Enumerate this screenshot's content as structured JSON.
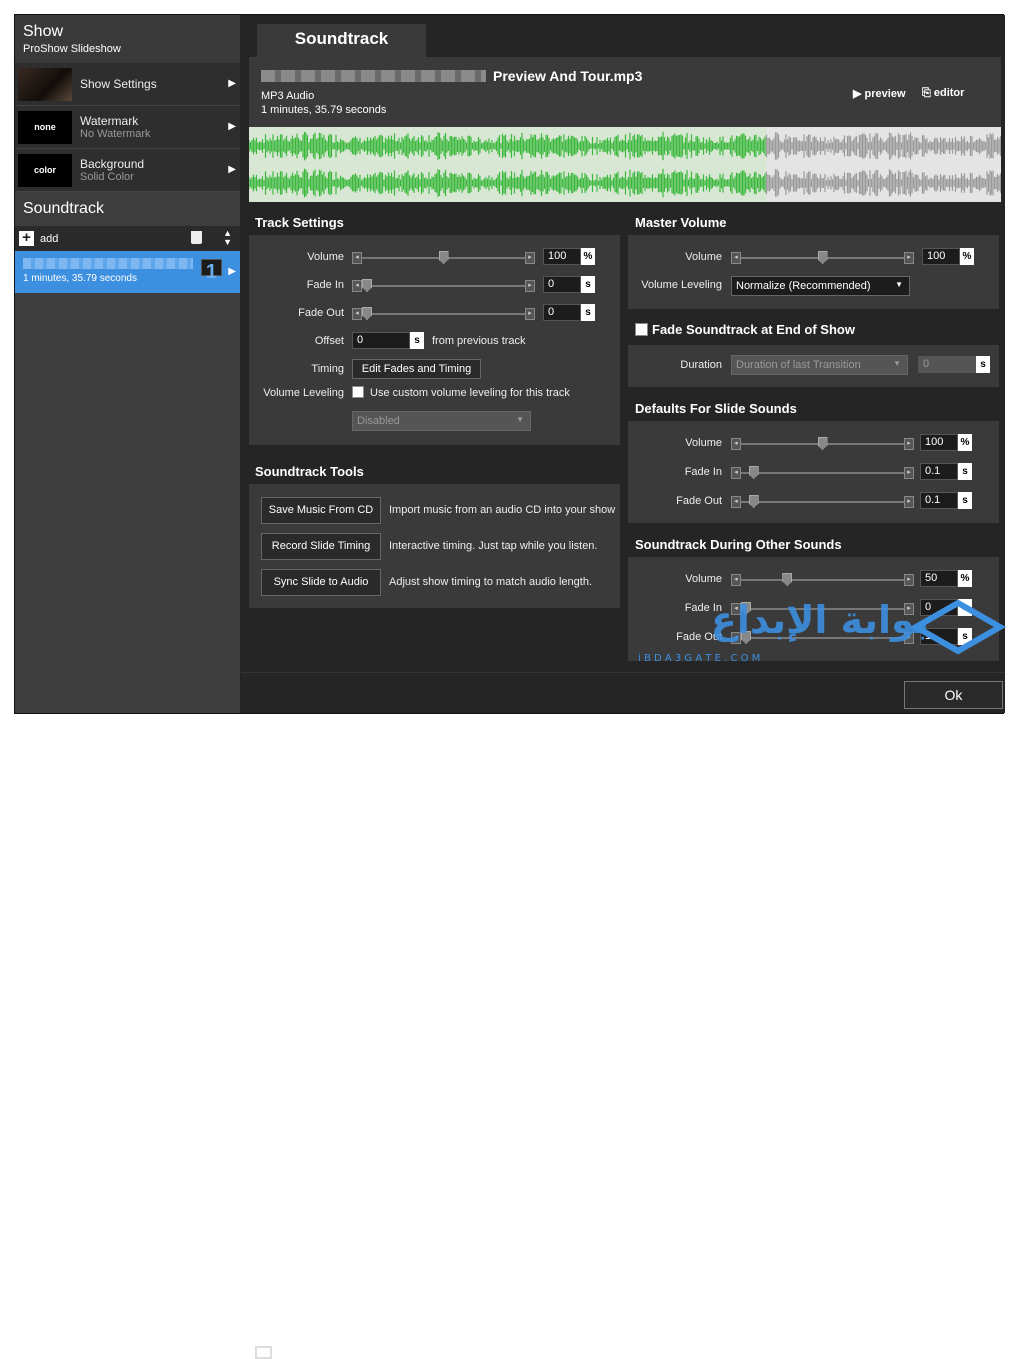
{
  "sidebar": {
    "show_title": "Show",
    "show_subtitle": "ProShow Slideshow",
    "items": [
      {
        "label": "Show Settings",
        "sub": "",
        "thumb": ""
      },
      {
        "label": "Watermark",
        "sub": "No Watermark",
        "thumb": "none"
      },
      {
        "label": "Background",
        "sub": "Solid Color",
        "thumb": "color"
      }
    ],
    "soundtrack_heading": "Soundtrack",
    "add_label": "add",
    "track": {
      "duration": "1 minutes, 35.79 seconds",
      "index": "1"
    }
  },
  "tab": "Soundtrack",
  "file": {
    "name": "Preview And Tour.mp3",
    "type": "MP3 Audio",
    "length": "1 minutes, 35.79 seconds",
    "preview_label": "preview",
    "editor_label": "editor",
    "played_fraction": 0.688
  },
  "track_settings": {
    "title": "Track Settings",
    "volume": {
      "label": "Volume",
      "value": "100",
      "unit": "%",
      "level": 0.5
    },
    "fade_in": {
      "label": "Fade In",
      "value": "0",
      "unit": "s",
      "level": 0
    },
    "fade_out": {
      "label": "Fade Out",
      "value": "0",
      "unit": "s",
      "level": 0
    },
    "offset": {
      "label": "Offset",
      "value": "0",
      "unit": "s",
      "suffix": "from previous track"
    },
    "timing": {
      "label": "Timing",
      "button": "Edit Fades and Timing"
    },
    "leveling": {
      "label": "Volume Leveling",
      "checkbox": "Use custom volume leveling for this track",
      "dropdown": "Disabled"
    }
  },
  "master_volume": {
    "title": "Master Volume",
    "volume": {
      "label": "Volume",
      "value": "100",
      "unit": "%",
      "level": 0.5
    },
    "leveling": {
      "label": "Volume Leveling",
      "value": "Normalize (Recommended)"
    }
  },
  "fade_end": {
    "checkbox": "Fade Soundtrack at End of Show",
    "duration_label": "Duration",
    "duration_dropdown": "Duration of last Transition",
    "duration_value": "0",
    "unit": "s"
  },
  "slide_sounds": {
    "title": "Defaults For Slide Sounds",
    "volume": {
      "label": "Volume",
      "value": "100",
      "unit": "%",
      "level": 0.5
    },
    "fade_in": {
      "label": "Fade In",
      "value": "0.1",
      "unit": "s",
      "level": 0.05
    },
    "fade_out": {
      "label": "Fade Out",
      "value": "0.1",
      "unit": "s",
      "level": 0.05
    }
  },
  "other_sounds": {
    "title": "Soundtrack During Other Sounds",
    "volume": {
      "label": "Volume",
      "value": "50",
      "unit": "%",
      "level": 0.27
    },
    "fade_in": {
      "label": "Fade In",
      "value": "0",
      "unit": "s",
      "level": 0
    },
    "fade_out": {
      "label": "Fade Out",
      "value": "1",
      "unit": "s",
      "level": 0
    }
  },
  "tools": {
    "title": "Soundtrack Tools",
    "items": [
      {
        "button": "Save Music From CD",
        "desc": "Import music from an audio CD into your show"
      },
      {
        "button": "Record Slide Timing",
        "desc": "Interactive timing. Just tap while you listen."
      },
      {
        "button": "Sync Slide to Audio",
        "desc": "Adjust show timing to match audio length."
      }
    ]
  },
  "ok_label": "Ok",
  "watermark": {
    "arabic": "بوابة الإبداع",
    "latin": "i B D A 3 G A T E . C O M"
  }
}
